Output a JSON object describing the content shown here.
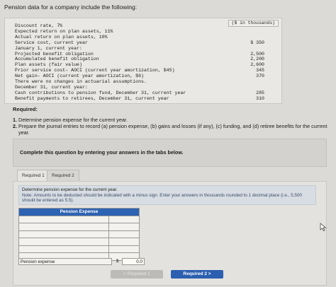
{
  "intro": "Pension data for a company include the following:",
  "unit_note": "($ in thousands)",
  "data_rows": [
    {
      "label": "Discount rate, 7%",
      "value": ""
    },
    {
      "label": "Expected return on plan assets, 11%",
      "value": ""
    },
    {
      "label": "Actual return on plan assets, 10%",
      "value": ""
    },
    {
      "label": "Service cost, current year",
      "value": "$ 350"
    },
    {
      "label": "January 1, current year:",
      "value": ""
    },
    {
      "label": "Projected benefit obligation",
      "value": "2,500"
    },
    {
      "label": "Accumulated benefit obligation",
      "value": "2,200"
    },
    {
      "label": "Plan assets (fair value)",
      "value": "2,600"
    },
    {
      "label": "Prior service cost– AOCI (current year amortization, $45)",
      "value": "345"
    },
    {
      "label": "Net gain– AOCI (current year amortization, $6)",
      "value": "370"
    },
    {
      "label": "There were no changes in actuarial assumptions.",
      "value": ""
    },
    {
      "label": "December 31, current year:",
      "value": ""
    },
    {
      "label": "Cash contributions to pension fund, December 31, current year",
      "value": "285"
    },
    {
      "label": "Benefit payments to retirees, December 31, current year",
      "value": "310"
    }
  ],
  "required_title": "Required:",
  "requirements": [
    {
      "num": "1.",
      "text": "Determine pension expense for the current year."
    },
    {
      "num": "2.",
      "text": "Prepare the journal entries to record (a) pension expense, (b) gains and losses (if any), (c) funding, and (d) retiree benefits for the current year."
    }
  ],
  "complete_prompt": "Complete this question by entering your answers in the tabs below.",
  "tabs": [
    "Required 1",
    "Required 2"
  ],
  "instructions_main": "Determine pension expense for the current year.",
  "instructions_note": "Note: Amounts to be deducted should be indicated with a minus sign. Enter your answers in thousands rounded to 1 decimal place (i.e., 5,500 should be entered as 5.5).",
  "table_header": "Pension Expense",
  "result_label": "Pension expense",
  "result_currency": "$",
  "result_value": "0.0",
  "prev_button": "< Required 1",
  "next_button": "Required 2  >",
  "colors": {
    "accent": "#2c5fb0",
    "header": "#2d63b3"
  }
}
